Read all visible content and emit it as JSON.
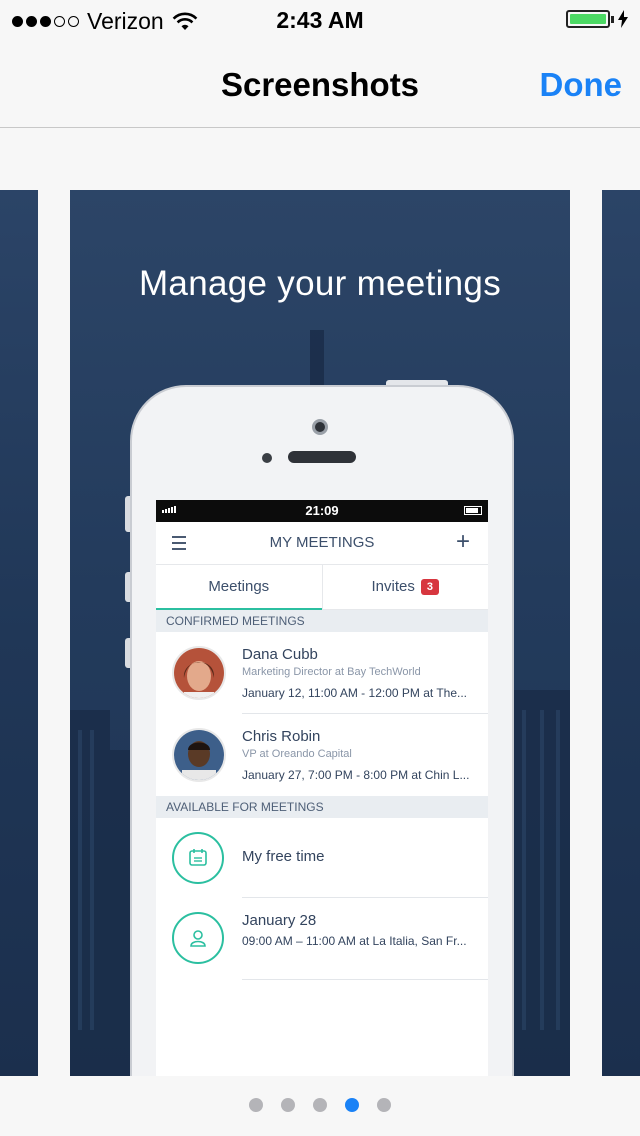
{
  "status_bar": {
    "carrier": "Verizon",
    "time": "2:43 AM",
    "signal_bars_filled": 3,
    "signal_bars_total": 5
  },
  "nav": {
    "title": "Screenshots",
    "done_label": "Done"
  },
  "promo": {
    "headline": "Manage your meetings"
  },
  "app_screen": {
    "status_time": "21:09",
    "title": "MY MEETINGS",
    "tabs": [
      {
        "label": "Meetings"
      },
      {
        "label": "Invites",
        "badge": "3"
      }
    ],
    "sections": {
      "confirmed": "CONFIRMED MEETINGS",
      "available": "AVAILABLE FOR MEETINGS"
    },
    "confirmed_meetings": [
      {
        "name": "Dana Cubb",
        "role": "Marketing Director at Bay TechWorld",
        "when": "January 12, 11:00 AM - 12:00 PM at The..."
      },
      {
        "name": "Chris Robin",
        "role": "VP at Oreando Capital",
        "when": "January 27, 7:00 PM - 8:00 PM at Chin L..."
      }
    ],
    "available": [
      {
        "label": "My free time",
        "icon": "calendar-icon"
      },
      {
        "label": "January 28",
        "detail": "09:00 AM – 11:00 AM at La Italia, San Fr...",
        "icon": "person-icon"
      }
    ]
  },
  "pager": {
    "count": 5,
    "current_index": 3
  },
  "colors": {
    "accent": "#1a82f6",
    "teal": "#2bbfa0",
    "badge": "#d7363f",
    "card_bg": "#233b5c"
  }
}
